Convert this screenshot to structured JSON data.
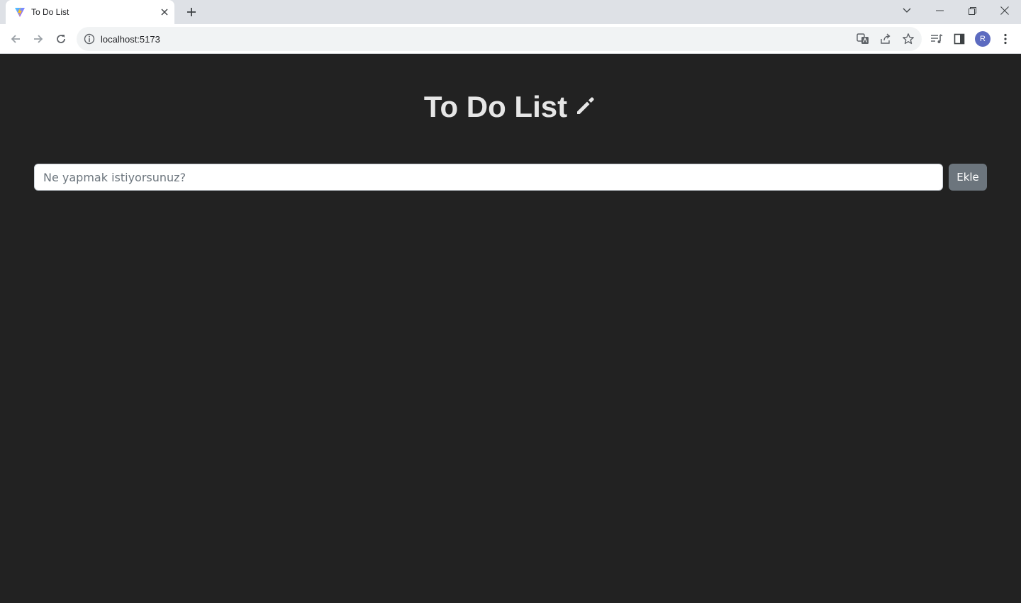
{
  "browser": {
    "tab_title": "To Do List",
    "url": "localhost:5173",
    "profile_initial": "R",
    "icons": [
      "vite-favicon-icon",
      "close-icon",
      "plus-icon",
      "chevron-down-icon",
      "minimize-icon",
      "restore-icon",
      "close-window-icon",
      "back-arrow-icon",
      "forward-arrow-icon",
      "reload-icon",
      "info-icon",
      "translate-icon",
      "share-icon",
      "star-icon",
      "media-queue-icon",
      "side-panel-icon",
      "more-vert-icon"
    ]
  },
  "app": {
    "title": "To Do List",
    "title_icon": "pencil-icon",
    "input_placeholder": "Ne yapmak istiyorsunuz?",
    "input_value": "",
    "add_button_label": "Ekle"
  },
  "colors": {
    "page_background": "#222222",
    "heading_text": "#e6e6e6",
    "button_background": "#6c757d"
  }
}
